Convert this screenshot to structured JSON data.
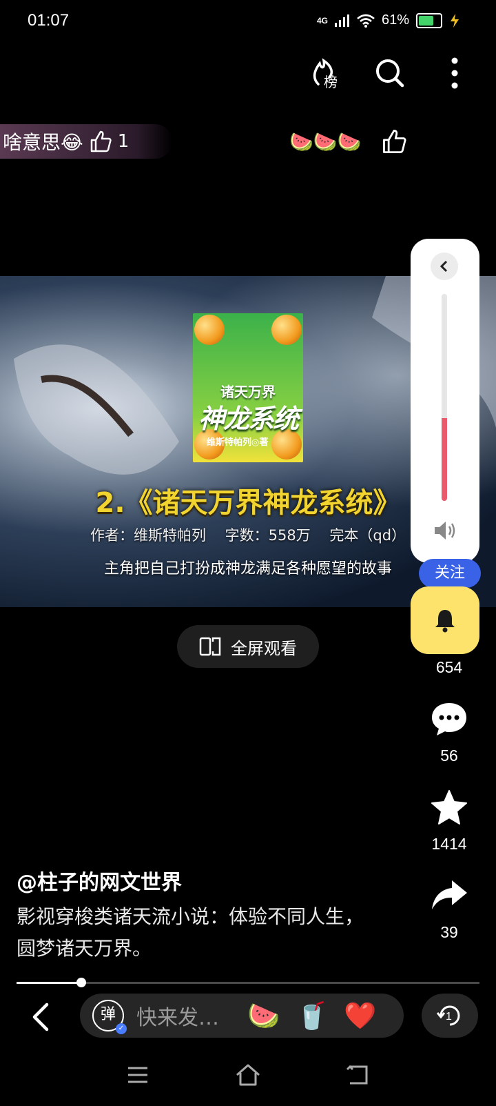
{
  "status_bar": {
    "time": "01:07",
    "network": "4G",
    "battery_percent": "61%",
    "battery_level": 0.61
  },
  "top_bar": {
    "icons": [
      "ranking-icon",
      "search-icon",
      "more-icon"
    ],
    "ranking_label": "榜"
  },
  "danmaku": {
    "text": "啥意思😂",
    "like_count": "1",
    "reaction_emojis": "🍉🍉🍉"
  },
  "video": {
    "cover": {
      "line1": "诸天万界",
      "line2": "神龙系统",
      "author_line": "维斯特帕列◎著"
    },
    "title": "2.《诸天万界神龙系统》",
    "meta": "作者：维斯特帕列　 字数：558万　 完本（qd）",
    "description": "主角把自己打扮成神龙满足各种愿望的故事",
    "fullscreen_label": "全屏观看"
  },
  "volume_panel": {
    "level": 0.4
  },
  "side_rail": {
    "follow_label": "关注",
    "like_count": "654",
    "comment_count": "56",
    "favorite_count": "1414",
    "share_count": "39"
  },
  "post": {
    "author": "@柱子的网文世界",
    "description": "影视穿梭类诸天流小说：体验不同人生，圆梦诸天万界。"
  },
  "playback": {
    "progress": 0.14
  },
  "bottom_bar": {
    "danmaku_toggle_label": "弹",
    "input_placeholder": "快来发…",
    "quick_emojis": [
      "🍉",
      "🥤",
      "❤️"
    ],
    "replay_label": "1"
  },
  "colors": {
    "accent_blue": "#3a62e6",
    "bell_yellow": "#fde36b",
    "volume_red": "#e95a6c",
    "title_gold": "#f2d431"
  }
}
